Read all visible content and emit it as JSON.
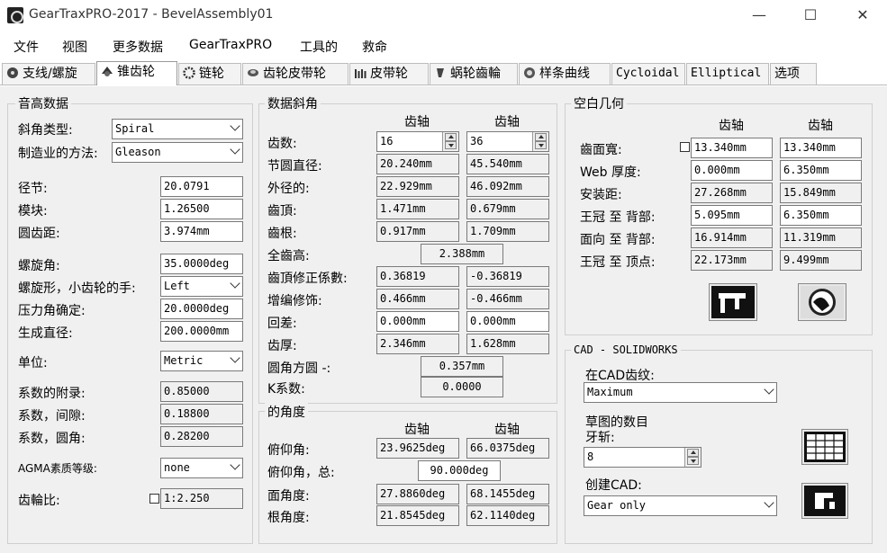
{
  "window": {
    "title": "GearTraxPRO-2017 - BevelAssembly01",
    "minimize": "—",
    "maximize": "☐",
    "close": "✕"
  },
  "menu": [
    "文件",
    "视图",
    "更多数据",
    "GearTraxPRO",
    "工具的",
    "救命"
  ],
  "tabs": [
    {
      "label": "支线/螺旋",
      "icon": "gear-icon"
    },
    {
      "label": "锥齿轮",
      "icon": "bevel-gear-icon"
    },
    {
      "label": "链轮",
      "icon": "sprocket-icon"
    },
    {
      "label": "齿轮皮带轮",
      "icon": "timing-pulley-icon"
    },
    {
      "label": "皮带轮",
      "icon": "pulley-icon"
    },
    {
      "label": "蜗轮齒輪",
      "icon": "worm-gear-icon"
    },
    {
      "label": "样条曲线",
      "icon": "spline-icon"
    },
    {
      "label": "Cycloidal",
      "icon": ""
    },
    {
      "label": "Elliptical",
      "icon": ""
    },
    {
      "label": "选项",
      "icon": ""
    }
  ],
  "pitch": {
    "title": "音高数据",
    "bevel_type_label": "斜角类型:",
    "bevel_type": "Spiral",
    "method_label": "制造业的方法:",
    "method": "Gleason",
    "diametral_pitch_label": "径节:",
    "diametral_pitch": "20.0791",
    "module_label": "模块:",
    "module": "1.26500",
    "circular_pitch_label": "圆齿距:",
    "circular_pitch": "3.974mm",
    "spiral_angle_label": "螺旋角:",
    "spiral_angle": "35.0000deg",
    "hand_label": "螺旋形，小齿轮的手:",
    "hand": "Left",
    "pressure_angle_label": "压力角确定:",
    "pressure_angle": "20.0000deg",
    "gen_diameter_label": "生成直径:",
    "gen_diameter": "200.0000mm",
    "units_label": "单位:",
    "units": "Metric",
    "addendum_label": "系数的附录:",
    "addendum": "0.85000",
    "clearance_label": "系数，间隙:",
    "clearance": "0.18800",
    "fillet_label": "系数，圆角:",
    "fillet": "0.28200",
    "agma_label": "AGMA素质等级:",
    "agma": "none",
    "ratio_label": "齿輪比:",
    "ratio": "1:2.250"
  },
  "data": {
    "title": "数据斜角",
    "col_pinion": "齿轴",
    "col_gear": "齿轴",
    "teeth_label": "齿数:",
    "teeth": [
      "16",
      "36"
    ],
    "pitch_dia_label": "节圆直径:",
    "pitch_dia": [
      "20.240mm",
      "45.540mm"
    ],
    "outside_dia_label": "外径的:",
    "outside_dia": [
      "22.929mm",
      "46.092mm"
    ],
    "addendum_label": "齒頂:",
    "addendum": [
      "1.471mm",
      "0.679mm"
    ],
    "dedendum_label": "齒根:",
    "dedendum": [
      "0.917mm",
      "1.709mm"
    ],
    "whole_depth_label": "全齒高:",
    "whole_depth": "2.388mm",
    "adden_mod_label": "齒頂修正係數:",
    "adden_mod": [
      "0.36819",
      "-0.36819"
    ],
    "thick_mod_label": "增编修饰:",
    "thick_mod": [
      "0.466mm",
      "-0.466mm"
    ],
    "backlash_label": "回差:",
    "backlash": [
      "0.000mm",
      "0.000mm"
    ],
    "thickness_label": "齿厚:",
    "thickness": [
      "2.346mm",
      "1.628mm"
    ],
    "fillet_label": "圆角方圆 -:",
    "fillet": "0.357mm",
    "k_label": "K系数:",
    "k": "0.0000"
  },
  "angles": {
    "title": "的角度",
    "col_pinion": "齿轴",
    "col_gear": "齿轴",
    "pitch_angle_label": "俯仰角:",
    "pitch_angle": [
      "23.9625deg",
      "66.0375deg"
    ],
    "total_label": "俯仰角，总:",
    "total": "90.000deg",
    "face_angle_label": "面角度:",
    "face_angle": [
      "27.8860deg",
      "68.1455deg"
    ],
    "root_angle_label": "根角度:",
    "root_angle": [
      "21.8545deg",
      "62.1140deg"
    ]
  },
  "blank": {
    "title": "空白几何",
    "col_pinion": "齿轴",
    "col_gear": "齿轴",
    "face_width_label": "齒面寬:",
    "face_width": [
      "13.340mm",
      "13.340mm"
    ],
    "web_label": "Web 厚度:",
    "web": [
      "0.000mm",
      "6.350mm"
    ],
    "mounting_label": "安装距:",
    "mounting": [
      "27.268mm",
      "15.849mm"
    ],
    "crown_back_label": "王冠 至 背部:",
    "crown_back": [
      "5.095mm",
      "6.350mm"
    ],
    "face_back_label": "面向 至 背部:",
    "face_back": [
      "16.914mm",
      "11.319mm"
    ],
    "crown_apex_label": "王冠 至 顶点:",
    "crown_apex": [
      "22.173mm",
      "9.499mm"
    ]
  },
  "cad": {
    "title": "CAD - SOLIDWORKS",
    "teeth_in_cad_label": "在CAD齿纹:",
    "teeth_in_cad": "Maximum",
    "sketch_count_label1": "草图的数目",
    "sketch_count_label2": "牙斩:",
    "sketch_count": "8",
    "create_label": "创建CAD:",
    "create": "Gear only"
  }
}
